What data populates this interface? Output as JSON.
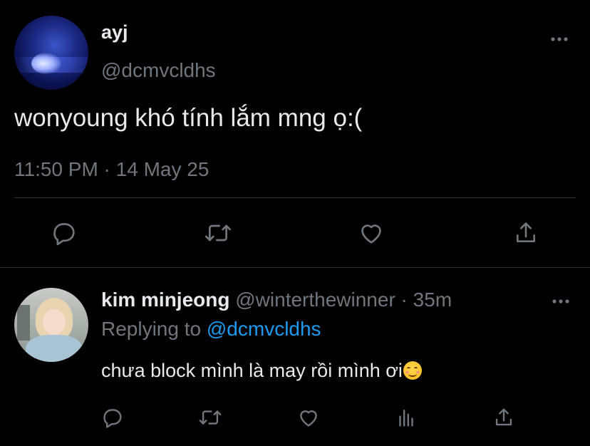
{
  "main_tweet": {
    "display_name": "ayj",
    "handle": "@dcmvcldhs",
    "text": "wonyoung khó tính lắm mng ọ:(",
    "time": "11:50 PM",
    "separator": " · ",
    "date": "14 May 25",
    "actions": [
      "reply-icon",
      "retweet-icon",
      "like-icon",
      "share-icon"
    ]
  },
  "reply_tweet": {
    "display_name": "kim minjeong",
    "handle": "@winterthewinner",
    "separator": " · ",
    "age": "35m",
    "replying_to_label": "Replying to ",
    "replying_to_handle": "@dcmvcldhs",
    "text": "chưa block mình là may rồi mình ơi",
    "emoji": "smiling-face-emoji",
    "actions": [
      "reply-icon",
      "retweet-icon",
      "like-icon",
      "analytics-icon",
      "share-icon"
    ]
  },
  "colors": {
    "background": "#000000",
    "primary_text": "#e7e9ea",
    "secondary_text": "#71767b",
    "accent": "#1d9bf0",
    "divider": "#2f3336"
  }
}
